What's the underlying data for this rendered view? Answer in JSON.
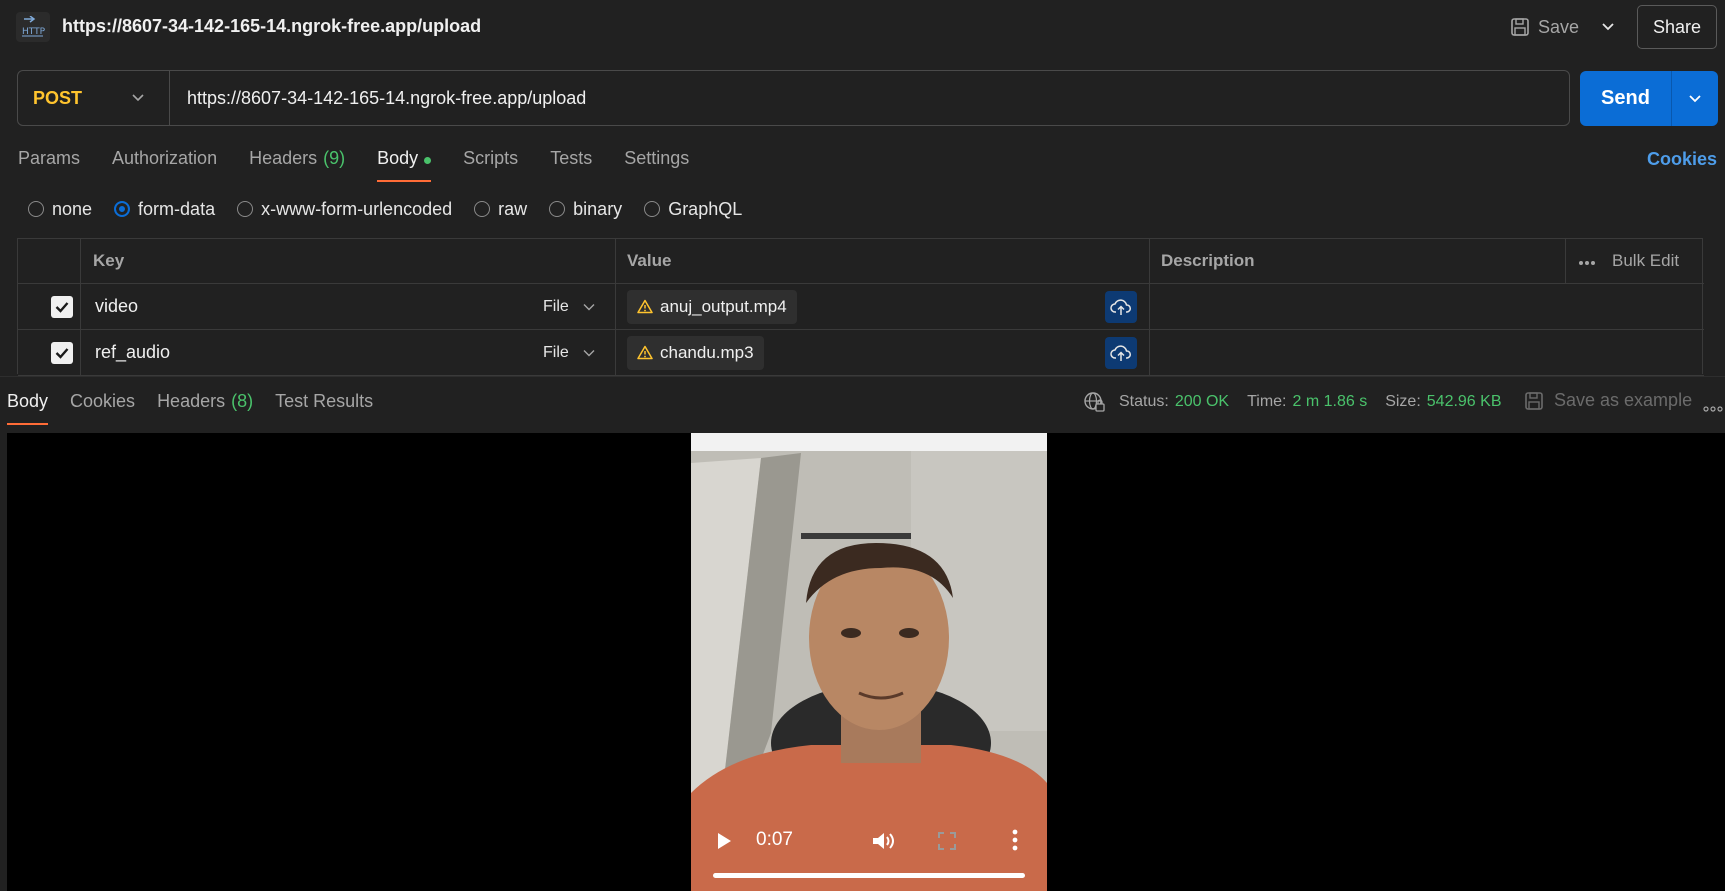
{
  "request": {
    "title": "https://8607-34-142-165-14.ngrok-free.app/upload",
    "method": "POST",
    "url": "https://8607-34-142-165-14.ngrok-free.app/upload"
  },
  "toolbar": {
    "save_label": "Save",
    "share_label": "Share",
    "send_label": "Send"
  },
  "request_tabs": [
    {
      "label": "Params"
    },
    {
      "label": "Authorization"
    },
    {
      "label": "Headers",
      "count": "(9)"
    },
    {
      "label": "Body"
    },
    {
      "label": "Scripts"
    },
    {
      "label": "Tests"
    },
    {
      "label": "Settings"
    }
  ],
  "cookies_label": "Cookies",
  "body_types": [
    "none",
    "form-data",
    "x-www-form-urlencoded",
    "raw",
    "binary",
    "GraphQL"
  ],
  "body_type_selected": "form-data",
  "table": {
    "headers": {
      "key": "Key",
      "value": "Value",
      "description": "Description",
      "bulk_edit": "Bulk Edit"
    },
    "rows": [
      {
        "key": "video",
        "type": "File",
        "value": "anuj_output.mp4",
        "checked": true
      },
      {
        "key": "ref_audio",
        "type": "File",
        "value": "chandu.mp3",
        "checked": true
      }
    ]
  },
  "response": {
    "tabs": [
      {
        "label": "Body"
      },
      {
        "label": "Cookies"
      },
      {
        "label": "Headers",
        "count": "(8)"
      },
      {
        "label": "Test Results"
      }
    ],
    "status_label": "Status:",
    "status_value": "200 OK",
    "time_label": "Time:",
    "time_value": "2 m 1.86 s",
    "size_label": "Size:",
    "size_value": "542.96 KB",
    "save_example_label": "Save as example",
    "video": {
      "time": "0:07",
      "progress": 1.0
    }
  },
  "colors": {
    "accent": "#ff6c37",
    "primary": "#0b6dd6",
    "success": "#4ac26b",
    "method_post": "#ffc42e",
    "link": "#4e9dea"
  }
}
